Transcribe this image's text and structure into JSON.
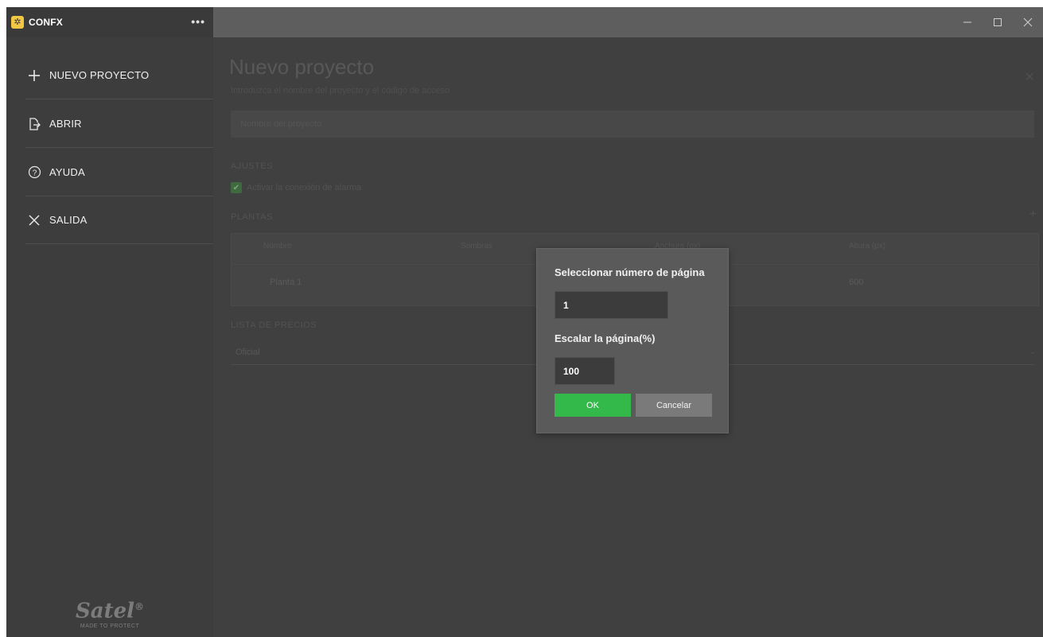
{
  "window": {
    "title": "CONFX",
    "more_label": "•••",
    "minimize_label": "—",
    "maximize_label": "☐",
    "close_label": "✕"
  },
  "sidebar": {
    "items": [
      {
        "label": "NUEVO PROYECTO",
        "icon": "plus-icon"
      },
      {
        "label": "ABRIR",
        "icon": "open-file-icon"
      },
      {
        "label": "AYUDA",
        "icon": "help-icon"
      },
      {
        "label": "SALIDA",
        "icon": "close-icon"
      }
    ],
    "brand": "Satel",
    "brand_mark": "®",
    "brand_tagline": "MADE TO PROTECT"
  },
  "main": {
    "title": "Nuevo proyecto",
    "subtitle": "Introduzca el nombre del proyecto y el código de acceso",
    "name_placeholder": "Nombre del proyecto",
    "section_ajustes": "AJUSTES",
    "checkbox_label": "Activar la conexión de alarma",
    "section_plantas": "PLANTAS",
    "table": {
      "headers": [
        "Nombre",
        "Sombras",
        "Anchura (px)",
        "Altura (px)"
      ],
      "rows": [
        {
          "name": "Planta 1",
          "height": "600"
        }
      ]
    },
    "section_lista": "LISTA DE PRECIOS",
    "select_value": "Oficial"
  },
  "dialog": {
    "page_label": "Seleccionar número de página",
    "page_value": "1",
    "scale_label": "Escalar la página(%)",
    "scale_value": "100",
    "ok_label": "OK",
    "cancel_label": "Cancelar"
  },
  "colors": {
    "accent_green": "#33b84a",
    "sidebar_bg": "#3d3d3d",
    "titlebar_bg": "#5e5e5e",
    "dialog_bg": "#5a5a5a"
  }
}
